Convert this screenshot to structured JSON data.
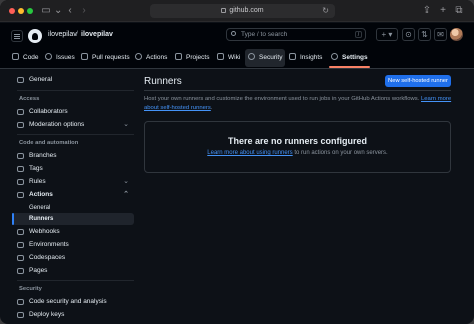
{
  "browser": {
    "url": "github.com"
  },
  "header": {
    "owner": "ilovepilav",
    "separator": "/",
    "repo": "ilovepilav",
    "search_placeholder": "Type / to search",
    "search_key": "/",
    "add_label": "+ ▾"
  },
  "tabs": [
    {
      "label": "Code",
      "icon": "code-icon"
    },
    {
      "label": "Issues",
      "icon": "issue-icon"
    },
    {
      "label": "Pull requests",
      "icon": "pull-request-icon"
    },
    {
      "label": "Actions",
      "icon": "play-icon"
    },
    {
      "label": "Projects",
      "icon": "table-icon"
    },
    {
      "label": "Wiki",
      "icon": "book-icon"
    },
    {
      "label": "Security",
      "icon": "shield-icon"
    },
    {
      "label": "Insights",
      "icon": "graph-icon"
    },
    {
      "label": "Settings",
      "icon": "gear-icon"
    }
  ],
  "sidebar": {
    "general": "General",
    "access_heading": "Access",
    "collaborators": "Collaborators",
    "moderation": "Moderation options",
    "code_heading": "Code and automation",
    "branches": "Branches",
    "tags": "Tags",
    "rules": "Rules",
    "actions": "Actions",
    "actions_general": "General",
    "runners": "Runners",
    "webhooks": "Webhooks",
    "environments": "Environments",
    "codespaces": "Codespaces",
    "pages": "Pages",
    "security_heading": "Security",
    "code_security": "Code security and analysis",
    "deploy_keys": "Deploy keys"
  },
  "main": {
    "title": "Runners",
    "new_button": "New self-hosted runner",
    "description": "Host your own runners and customize the environment used to run jobs in your GitHub Actions workflows.",
    "learn_more": "Learn more about self-hosted runners",
    "learn_more_suffix": ".",
    "empty_title": "There are no runners configured",
    "empty_link": "Learn more about using runners",
    "empty_suffix": " to run actions on your own servers."
  },
  "colors": {
    "accent": "#1f6feb",
    "tab_underline": "#f78166",
    "link": "#4493f8",
    "background": "#0d1117"
  }
}
